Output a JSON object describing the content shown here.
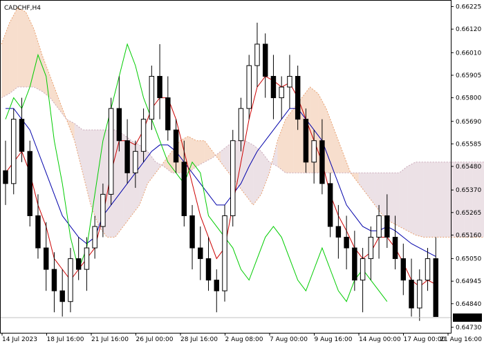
{
  "window": {
    "symbol_timeframe": "CADCHF,H4"
  },
  "chart_data": {
    "type": "candlestick",
    "title": "CADCHF,H4",
    "ylim": [
      0.6473,
      0.6623
    ],
    "y_ticks": [
      "0.66225",
      "0.66120",
      "0.66010",
      "0.65905",
      "0.65800",
      "0.65690",
      "0.65585",
      "0.65480",
      "0.65370",
      "0.65265",
      "0.65160",
      "0.65050",
      "0.64945",
      "0.64840",
      "0.64730"
    ],
    "x_ticks": [
      "14 Jul 2023",
      "18 Jul 16:00",
      "21 Jul 16:00",
      "26 Jul 00:00",
      "28 Jul 16:00",
      "2 Aug 08:00",
      "7 Aug 00:00",
      "9 Aug 16:00",
      "14 Aug 00:00",
      "17 Aug 00:00",
      "21 Aug 16:00"
    ],
    "current_price": "0.64775",
    "current_price_value": 0.64775,
    "colors": {
      "background": "#ffffff",
      "candle_bull": "#ffffff",
      "candle_bear": "#000000",
      "candle_outline": "#000000",
      "tenkan_sen": "#cc0000",
      "kijun_sen": "#0000aa",
      "chikou_span": "#00cc00",
      "cloud_bull": "#e8a070",
      "cloud_bear": "#c9a8b8",
      "price_tag_bg": "#000000",
      "price_tag_text": "#ffffff",
      "grid": "#c0c0c0"
    },
    "candles": [
      [
        0.6546,
        0.656,
        0.653,
        0.654
      ],
      [
        0.654,
        0.6575,
        0.6535,
        0.657
      ],
      [
        0.657,
        0.658,
        0.655,
        0.6555
      ],
      [
        0.6555,
        0.656,
        0.652,
        0.6525
      ],
      [
        0.6525,
        0.6535,
        0.6505,
        0.651
      ],
      [
        0.651,
        0.6522,
        0.649,
        0.65
      ],
      [
        0.65,
        0.6508,
        0.648,
        0.649
      ],
      [
        0.649,
        0.65,
        0.6478,
        0.6485
      ],
      [
        0.6485,
        0.651,
        0.648,
        0.6505
      ],
      [
        0.6505,
        0.6515,
        0.6495,
        0.65
      ],
      [
        0.65,
        0.6515,
        0.649,
        0.651
      ],
      [
        0.651,
        0.6525,
        0.6505,
        0.652
      ],
      [
        0.652,
        0.654,
        0.6515,
        0.6535
      ],
      [
        0.6535,
        0.658,
        0.653,
        0.6575
      ],
      [
        0.6575,
        0.659,
        0.6555,
        0.656
      ],
      [
        0.656,
        0.657,
        0.654,
        0.6545
      ],
      [
        0.6545,
        0.656,
        0.6538,
        0.6555
      ],
      [
        0.6555,
        0.6575,
        0.655,
        0.657
      ],
      [
        0.657,
        0.6595,
        0.6565,
        0.659
      ],
      [
        0.659,
        0.6605,
        0.657,
        0.658
      ],
      [
        0.658,
        0.659,
        0.656,
        0.6565
      ],
      [
        0.6565,
        0.657,
        0.6545,
        0.655
      ],
      [
        0.655,
        0.656,
        0.652,
        0.6525
      ],
      [
        0.6525,
        0.653,
        0.65,
        0.651
      ],
      [
        0.651,
        0.652,
        0.6495,
        0.6505
      ],
      [
        0.6505,
        0.6515,
        0.649,
        0.6495
      ],
      [
        0.6495,
        0.65,
        0.648,
        0.649
      ],
      [
        0.649,
        0.653,
        0.6485,
        0.6525
      ],
      [
        0.6525,
        0.6565,
        0.652,
        0.656
      ],
      [
        0.656,
        0.658,
        0.6555,
        0.6575
      ],
      [
        0.6575,
        0.66,
        0.657,
        0.6595
      ],
      [
        0.6595,
        0.6615,
        0.6585,
        0.6605
      ],
      [
        0.6605,
        0.661,
        0.658,
        0.659
      ],
      [
        0.659,
        0.66,
        0.657,
        0.658
      ],
      [
        0.658,
        0.659,
        0.657,
        0.6585
      ],
      [
        0.6585,
        0.66,
        0.6575,
        0.659
      ],
      [
        0.659,
        0.6595,
        0.6565,
        0.657
      ],
      [
        0.657,
        0.6575,
        0.6545,
        0.655
      ],
      [
        0.655,
        0.6565,
        0.654,
        0.656
      ],
      [
        0.656,
        0.657,
        0.6535,
        0.654
      ],
      [
        0.654,
        0.6545,
        0.6515,
        0.652
      ],
      [
        0.652,
        0.653,
        0.6505,
        0.6515
      ],
      [
        0.6515,
        0.6525,
        0.65,
        0.651
      ],
      [
        0.651,
        0.6518,
        0.649,
        0.6495
      ],
      [
        0.6495,
        0.651,
        0.648,
        0.6505
      ],
      [
        0.6505,
        0.652,
        0.6495,
        0.6515
      ],
      [
        0.6515,
        0.653,
        0.6505,
        0.6525
      ],
      [
        0.6525,
        0.6535,
        0.651,
        0.6515
      ],
      [
        0.6515,
        0.6525,
        0.65,
        0.6505
      ],
      [
        0.6505,
        0.6512,
        0.6488,
        0.6495
      ],
      [
        0.6495,
        0.6505,
        0.6478,
        0.6482
      ],
      [
        0.6482,
        0.65,
        0.6476,
        0.6495
      ],
      [
        0.6495,
        0.651,
        0.649,
        0.6505
      ],
      [
        0.6505,
        0.6515,
        0.648,
        0.6478
      ]
    ],
    "tenkan_sen": [
      0.6545,
      0.655,
      0.6555,
      0.6545,
      0.653,
      0.652,
      0.6505,
      0.65,
      0.6495,
      0.65,
      0.6505,
      0.651,
      0.6525,
      0.6545,
      0.656,
      0.656,
      0.6558,
      0.6565,
      0.6575,
      0.658,
      0.658,
      0.657,
      0.6555,
      0.654,
      0.6525,
      0.6515,
      0.6505,
      0.651,
      0.653,
      0.655,
      0.657,
      0.6585,
      0.659,
      0.6588,
      0.6585,
      0.6587,
      0.658,
      0.657,
      0.656,
      0.655,
      0.6535,
      0.6525,
      0.6518,
      0.651,
      0.6505,
      0.6508,
      0.6515,
      0.6515,
      0.651,
      0.6503,
      0.6495,
      0.6492,
      0.6495,
      0.6493
    ],
    "kijun_sen": [
      0.6575,
      0.6575,
      0.657,
      0.6565,
      0.6555,
      0.6545,
      0.6535,
      0.6525,
      0.652,
      0.6515,
      0.6512,
      0.6515,
      0.6525,
      0.653,
      0.6535,
      0.654,
      0.6545,
      0.655,
      0.6555,
      0.6558,
      0.6558,
      0.6555,
      0.655,
      0.6545,
      0.654,
      0.6535,
      0.653,
      0.653,
      0.6535,
      0.654,
      0.6548,
      0.6555,
      0.656,
      0.6565,
      0.657,
      0.6575,
      0.6575,
      0.657,
      0.6565,
      0.656,
      0.655,
      0.654,
      0.653,
      0.6525,
      0.652,
      0.6518,
      0.6518,
      0.652,
      0.6518,
      0.6515,
      0.6512,
      0.651,
      0.6508,
      0.6506
    ],
    "chikou_span": [
      0.657,
      0.658,
      0.6575,
      0.6585,
      0.66,
      0.659,
      0.656,
      0.654,
      0.6515,
      0.65,
      0.651,
      0.6535,
      0.656,
      0.6575,
      0.659,
      0.6605,
      0.6595,
      0.658,
      0.657,
      0.656,
      0.655,
      0.6545,
      0.654,
      0.655,
      0.6545,
      0.6525,
      0.652,
      0.6515,
      0.651,
      0.65,
      0.6495,
      0.6505,
      0.6515,
      0.652,
      0.6515,
      0.6505,
      0.6495,
      0.649,
      0.65,
      0.651,
      0.65,
      0.649,
      0.6485,
      0.6495,
      0.65,
      0.6495,
      0.649,
      0.6485
    ],
    "senkou_a": [
      0.6605,
      0.6615,
      0.6622,
      0.662,
      0.6612,
      0.66,
      0.659,
      0.658,
      0.657,
      0.656,
      0.6545,
      0.653,
      0.652,
      0.6515,
      0.6515,
      0.652,
      0.6525,
      0.653,
      0.654,
      0.6545,
      0.655,
      0.6555,
      0.656,
      0.6562,
      0.656,
      0.656,
      0.6555,
      0.655,
      0.6545,
      0.654,
      0.6535,
      0.653,
      0.6535,
      0.6545,
      0.656,
      0.657,
      0.6575,
      0.658,
      0.6585,
      0.6582,
      0.6575,
      0.6565,
      0.6555,
      0.6545,
      0.654,
      0.6535,
      0.653,
      0.6525,
      0.6522,
      0.652,
      0.6518,
      0.6516,
      0.6515,
      0.6515,
      0.6515,
      0.6515,
      0.6515,
      0.6515,
      0.6515,
      0.6515,
      0.6515,
      0.6515,
      0.6515,
      0.6515,
      0.6515
    ],
    "senkou_b": [
      0.658,
      0.6582,
      0.6585,
      0.6585,
      0.6585,
      0.6583,
      0.658,
      0.6575,
      0.657,
      0.6568,
      0.6565,
      0.6565,
      0.6565,
      0.6565,
      0.6565,
      0.6563,
      0.656,
      0.6558,
      0.6555,
      0.655,
      0.6548,
      0.6545,
      0.6545,
      0.6545,
      0.6548,
      0.655,
      0.6552,
      0.6555,
      0.6558,
      0.656,
      0.656,
      0.6558,
      0.6555,
      0.655,
      0.6548,
      0.6545,
      0.6545,
      0.6545,
      0.6545,
      0.6545,
      0.6545,
      0.6545,
      0.6545,
      0.6545,
      0.6545,
      0.6545,
      0.6545,
      0.6545,
      0.6545,
      0.6545,
      0.6548,
      0.655,
      0.655,
      0.655,
      0.655,
      0.655,
      0.655,
      0.655,
      0.655,
      0.655,
      0.655,
      0.655,
      0.655,
      0.655,
      0.655
    ]
  }
}
